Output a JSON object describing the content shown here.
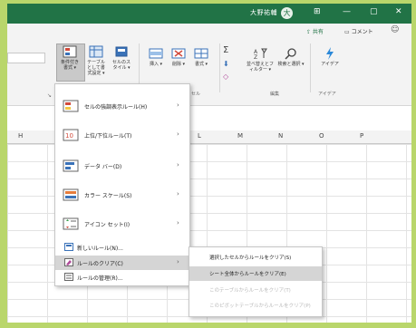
{
  "titlebar": {
    "user": "大野祐輔",
    "avatar": "大",
    "controls": [
      "⊞",
      "—",
      "▢",
      "✕"
    ]
  },
  "ribbon": {
    "share": "⇪ 共有",
    "comment": "▭ コメント",
    "tools": [
      {
        "label": "条件付き書式 ▾",
        "icon": "conditional-format-icon"
      },
      {
        "label": "テーブルとして書式設定 ▾",
        "icon": "format-as-table-icon"
      },
      {
        "label": "セルのスタイル ▾",
        "icon": "cell-styles-icon"
      },
      {
        "label": "挿入 ▾",
        "icon": "insert-cells-icon"
      },
      {
        "label": "削除 ▾",
        "icon": "delete-cells-icon"
      },
      {
        "label": "書式 ▾",
        "icon": "format-cells-icon"
      },
      {
        "label": "並べ替えとフィルター ▾",
        "icon": "sort-filter-icon"
      },
      {
        "label": "検索と選択 ▾",
        "icon": "find-select-icon"
      },
      {
        "label": "アイデア",
        "icon": "ideas-icon"
      }
    ],
    "groups": [
      "セル",
      "編集",
      "アイデア"
    ]
  },
  "sheet": {
    "columns": [
      "H",
      "L",
      "M",
      "N",
      "O",
      "P"
    ]
  },
  "menu": {
    "items": [
      {
        "label": "セルの強調表示ルール(H)",
        "has_submenu": true,
        "icon": "highlight-rules-icon"
      },
      {
        "label": "上位/下位ルール(T)",
        "has_submenu": true,
        "icon": "top-bottom-rules-icon"
      },
      {
        "label": "データ バー(D)",
        "has_submenu": true,
        "icon": "data-bars-icon"
      },
      {
        "label": "カラー スケール(S)",
        "has_submenu": true,
        "icon": "color-scales-icon"
      },
      {
        "label": "アイコン セット(I)",
        "has_submenu": true,
        "icon": "icon-sets-icon"
      },
      {
        "label": "新しいルール(N)...",
        "has_submenu": false,
        "icon": "new-rule-icon"
      },
      {
        "label": "ルールのクリア(C)",
        "has_submenu": true,
        "icon": "clear-rules-icon",
        "highlighted": true
      },
      {
        "label": "ルールの管理(R)...",
        "has_submenu": false,
        "icon": "manage-rules-icon"
      }
    ]
  },
  "submenu": {
    "items": [
      {
        "label": "選択したセルからルールをクリア(S)",
        "enabled": true
      },
      {
        "label": "シート全体からルールをクリア(E)",
        "enabled": true,
        "highlighted": true
      },
      {
        "label": "このテーブルからルールをクリア(T)",
        "enabled": false
      },
      {
        "label": "このピボットテーブルからルールをクリア(P)",
        "enabled": false
      }
    ]
  },
  "colors": {
    "titlebar": "#217346",
    "highlight": "#d5d5d5",
    "background": "#b9d66b"
  }
}
